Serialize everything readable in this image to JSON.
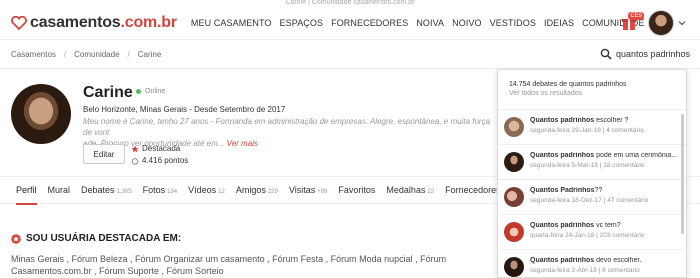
{
  "top_text": "Carine | Comunidade casamentos.com.br",
  "header": {
    "logo_pre": "casamentos",
    "logo_post": ".com.br",
    "nav": [
      "MEU CASAMENTO",
      "ESPAÇOS",
      "FORNECEDORES",
      "NOIVA",
      "NOIVO",
      "VESTIDOS",
      "IDEIAS",
      "COMUNIDADE"
    ],
    "gift_badge": "CE9"
  },
  "breadcrumb": [
    "Casamentos",
    "Comunidade",
    "Carine"
  ],
  "search": {
    "value": "quantos padrinhos",
    "placeholder": ""
  },
  "profile": {
    "name": "Carine",
    "status": "Online",
    "location": "Belo Horizonte, Minas Gerais - Desde Setembro de 2017",
    "bio_line1": "Meu nome é Carine, tenho 27 anos - Formanda em administração de empresas. Alegre, espontânea, e muita força de vont",
    "bio_line2": "ade. Procuro ver oportunidade até em...",
    "bio_more": "Ver mais",
    "edit_label": "Editar",
    "featured_label": "Destacada",
    "points_label": "4.416 pontos"
  },
  "tabs": [
    {
      "label": "Perfil",
      "count": ""
    },
    {
      "label": "Mural",
      "count": ""
    },
    {
      "label": "Debates",
      "count": "1.305"
    },
    {
      "label": "Fotos",
      "count": "134"
    },
    {
      "label": "Vídeos",
      "count": "12"
    },
    {
      "label": "Amigos",
      "count": "229"
    },
    {
      "label": "Visitas",
      "count": "+99"
    },
    {
      "label": "Favoritos",
      "count": ""
    },
    {
      "label": "Medalhas",
      "count": "22"
    },
    {
      "label": "Fornecedores",
      "count": ""
    }
  ],
  "featured": {
    "title": "SOU USUÁRIA DESTACADA EM:",
    "line1": "Minas Gerais , Fórum Beleza , Fórum Organizar um casamento , Fórum Festa , Fórum Moda nupcial , Fórum",
    "line2": "Casamentos.com.br , Fórum Suporte , Fórum Sorteio"
  },
  "dropdown": {
    "count_text": "14.754 debates de quantos padrinhos",
    "all_results": "Ver todos os resultados",
    "items": [
      {
        "bold": "Quantos padrinhos",
        "rest": " escolher ?",
        "meta": "segunda-feira 29-Jan-18 | 4 comentário"
      },
      {
        "bold": "Quantos padrinhos",
        "rest": " pode em uma cerimônia...",
        "meta": "segunda-feira 5-Mar-18 | 18 comentário"
      },
      {
        "bold": "Quantos Padrinhos",
        "rest": "??",
        "meta": "segunda-feira 18-Dez-17 | 47 comentário"
      },
      {
        "bold": "Quantos padrinhos",
        "rest": " vc tem?",
        "meta": "quarta-feira 24-Jan-18 | 203 comentário"
      },
      {
        "bold": "Quantos padrinhos",
        "rest": " devo escolher.",
        "meta": "segunda-feira 2-Abr-18 | 8 comentário"
      }
    ]
  },
  "colors": {
    "accent": "#d1463f",
    "online": "#5cb85c"
  }
}
